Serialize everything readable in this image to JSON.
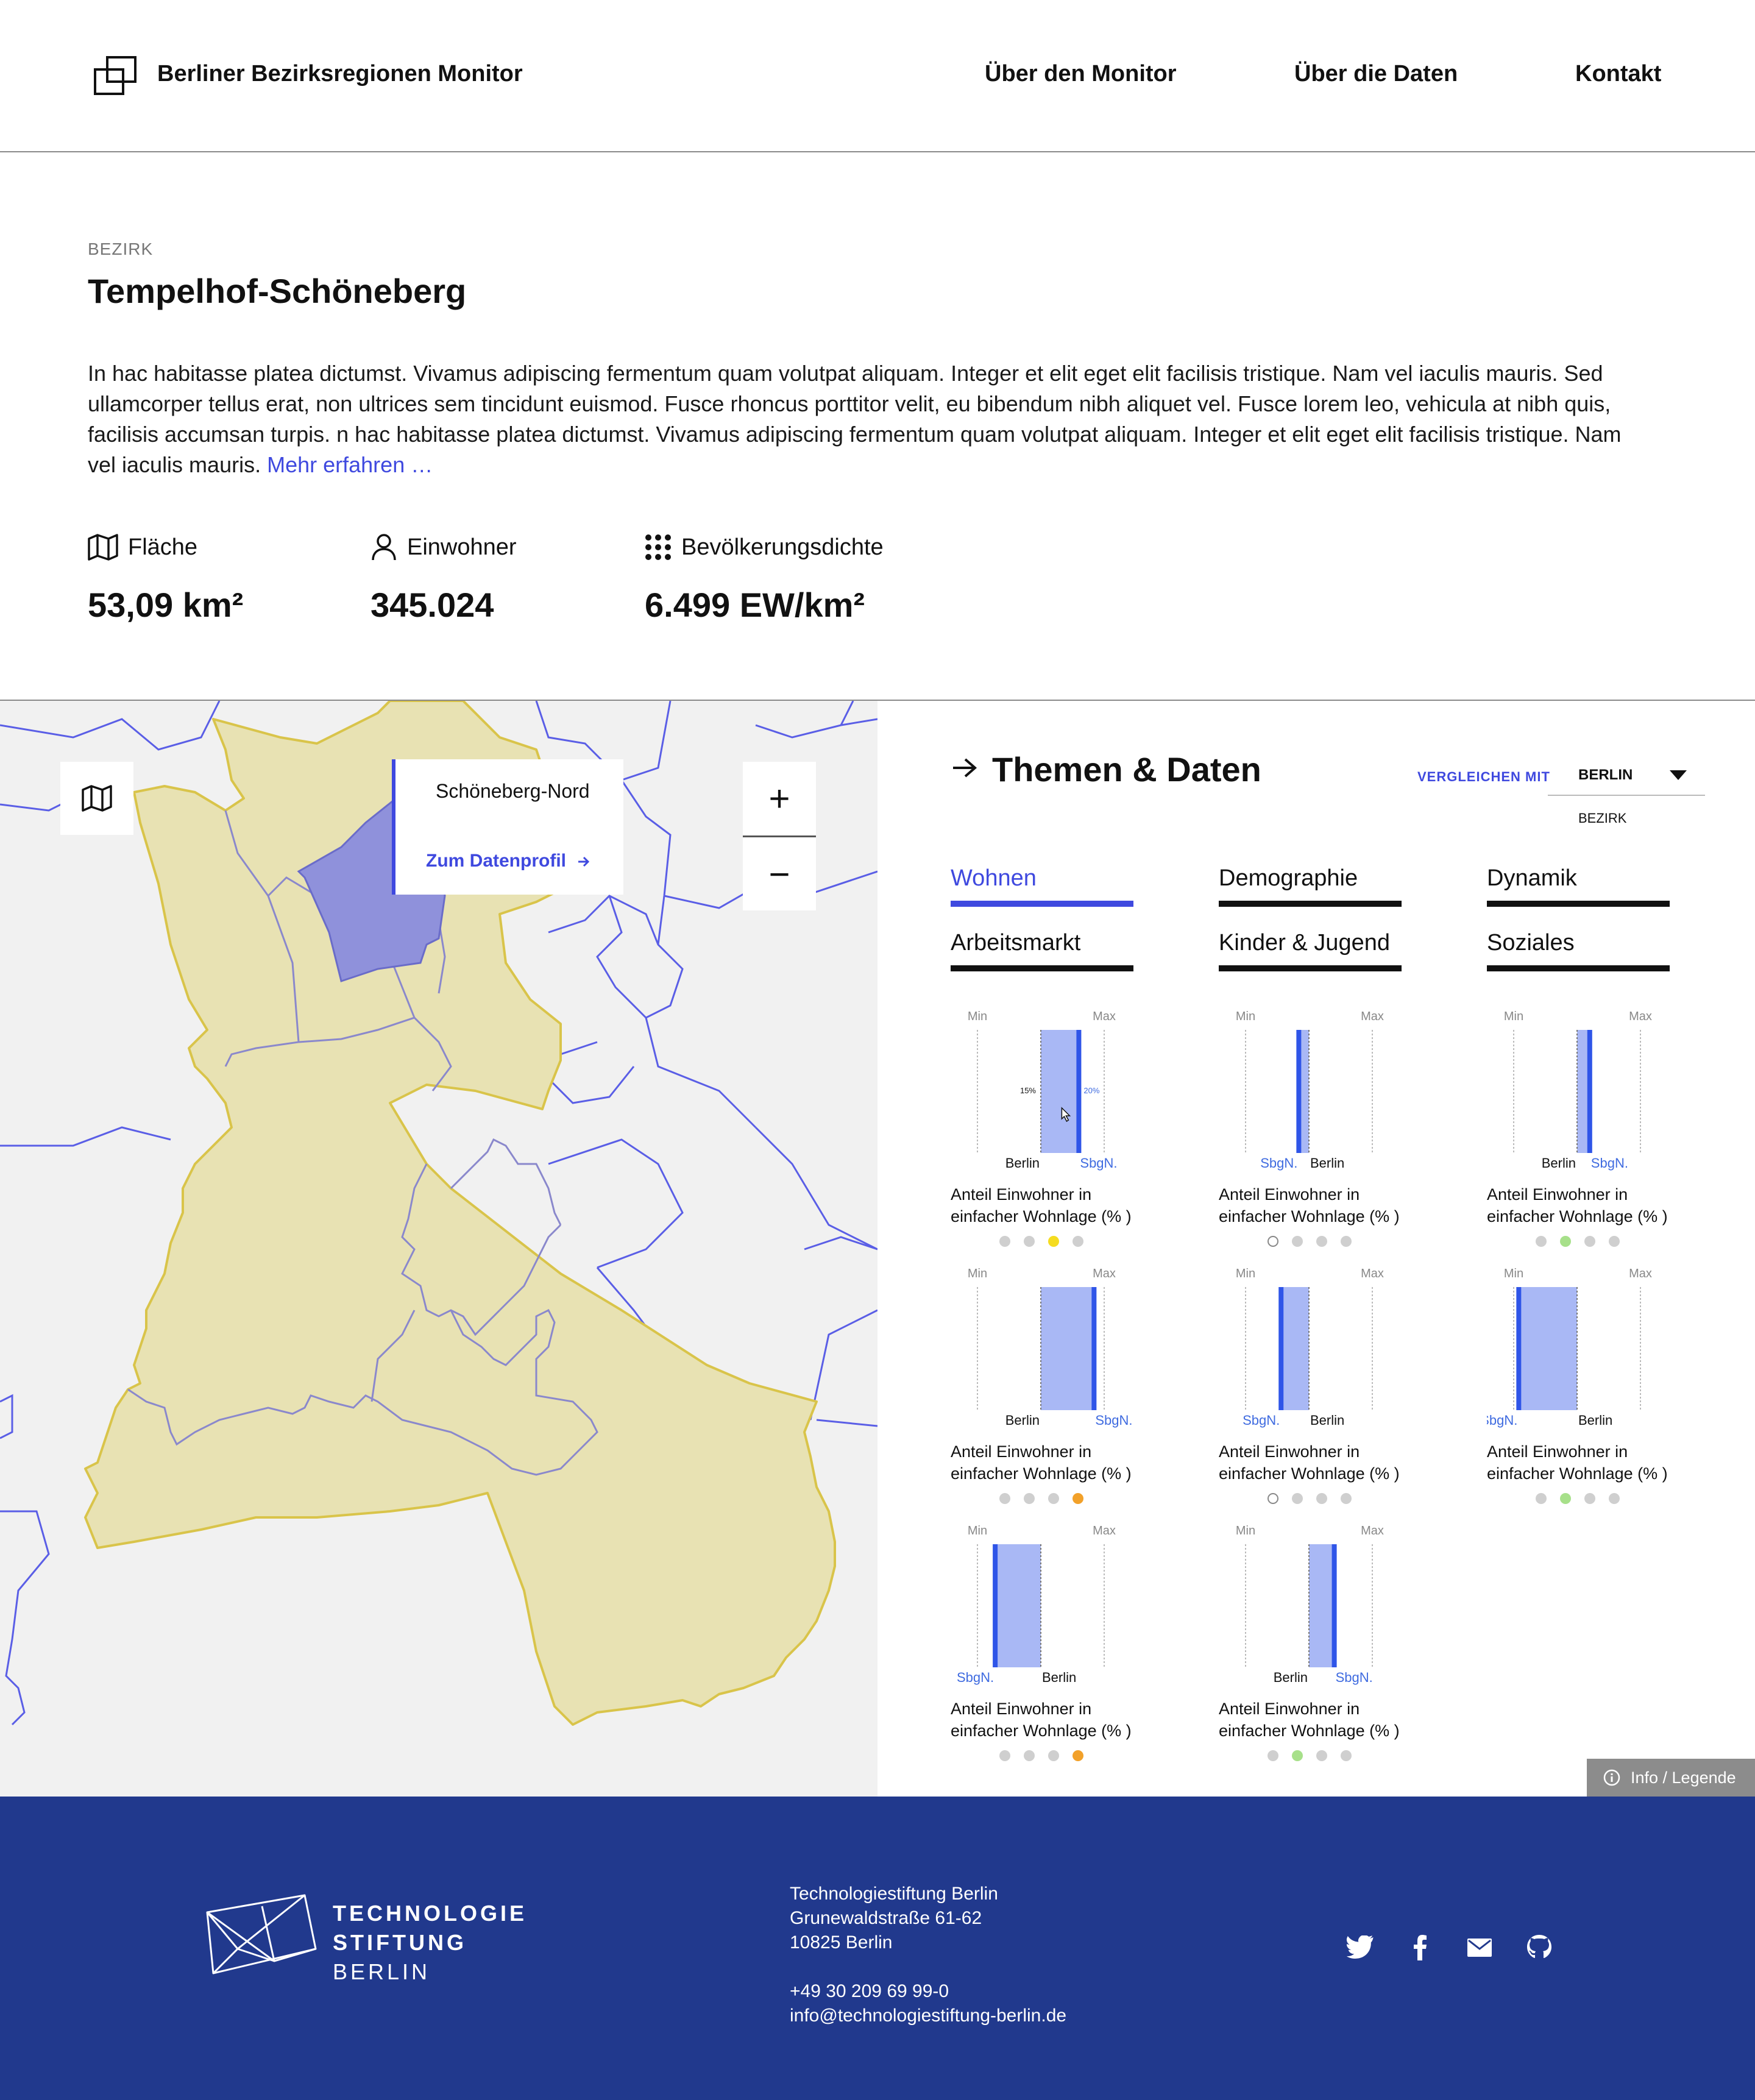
{
  "header": {
    "brand": "Berliner Bezirksregionen Monitor",
    "nav": [
      "Über den Monitor",
      "Über die Daten",
      "Kontakt"
    ]
  },
  "intro": {
    "kicker": "BEZIRK",
    "title": "Tempelhof-Schöneberg",
    "description": "In hac habitasse platea dictumst. Vivamus adipiscing fermentum quam volutpat aliquam. Integer et elit eget elit facilisis tristique. Nam vel iaculis mauris. Sed ullamcorper tellus erat, non ultrices sem tincidunt euismod. Fusce rhoncus porttitor velit, eu bibendum nibh aliquet vel. Fusce lorem leo, vehicula at nibh quis, facilisis accumsan turpis. n hac habitasse platea dictumst. Vivamus adipiscing fermentum quam volutpat aliquam. Integer et elit eget elit facilisis tristique. Nam vel iaculis mauris.",
    "more_link": "Mehr erfahren …",
    "stats": [
      {
        "icon": "map-icon",
        "label": "Fläche",
        "value": "53,09 km²"
      },
      {
        "icon": "person-icon",
        "label": "Einwohner",
        "value": "345.024"
      },
      {
        "icon": "density-grid-icon",
        "label": "Bevölkerungsdichte",
        "value": "6.499 EW/km²"
      }
    ]
  },
  "map": {
    "popup_name": "Schöneberg-Nord",
    "popup_link": "Zum Datenprofil",
    "zoom_in": "+",
    "zoom_out": "−",
    "colors": {
      "district_fill": "#e8e2b3",
      "district_stroke": "#d9c44a",
      "region_stroke": "#8a88cc",
      "selected": "#8f91db",
      "other_stroke": "#5a5ee6",
      "background": "#f1f1f1"
    }
  },
  "panel": {
    "title": "Themen & Daten",
    "compare_label": "VERGLEICHEN MIT",
    "compare_value": "BERLIN",
    "compare_option": "BEZIRK",
    "tabs": [
      "Wohnen",
      "Demographie",
      "Dynamik",
      "Arbeitsmarkt",
      "Kinder & Jugend",
      "Soziales"
    ],
    "active_tab": "Wohnen",
    "axis_min": "Min",
    "axis_max": "Max",
    "berlin_label": "Berlin",
    "region_label": "SbgN.",
    "indicator_label": "Anteil Einwohner in einfacher Wohnlage (% )",
    "first_berlin_value": "15%",
    "first_region_value": "20%",
    "indicators": [
      {
        "berlin": 0.5,
        "region": 0.8,
        "status": [
          "grey",
          "grey",
          "yellow",
          "grey"
        ]
      },
      {
        "berlin": 0.5,
        "region": 0.42,
        "status": [
          "hollow",
          "grey",
          "grey",
          "grey"
        ]
      },
      {
        "berlin": 0.5,
        "region": 0.6,
        "status": [
          "grey",
          "green",
          "grey",
          "grey"
        ]
      },
      {
        "berlin": 0.5,
        "region": 0.92,
        "status": [
          "grey",
          "grey",
          "grey",
          "orange"
        ]
      },
      {
        "berlin": 0.5,
        "region": 0.28,
        "status": [
          "hollow",
          "grey",
          "grey",
          "grey"
        ]
      },
      {
        "berlin": 0.5,
        "region": 0.04,
        "status": [
          "grey",
          "green",
          "grey",
          "grey"
        ]
      },
      {
        "berlin": 0.5,
        "region": 0.14,
        "status": [
          "grey",
          "grey",
          "grey",
          "orange"
        ]
      },
      {
        "berlin": 0.5,
        "region": 0.7,
        "status": [
          "grey",
          "green",
          "grey",
          "grey"
        ]
      }
    ],
    "status_colors": {
      "grey": "#cfcfcf",
      "yellow": "#f5dc20",
      "green": "#a7e08a",
      "orange": "#f2a12a"
    },
    "info_button": "Info / Legende"
  },
  "footer": {
    "brand_lines": [
      "TECHNOLOGIE",
      "STIFTUNG",
      "BERLIN"
    ],
    "address": [
      "Technologiestiftung Berlin",
      "Grunewaldstraße 61-62",
      "10825 Berlin",
      "",
      "+49 30 209 69 99-0",
      "info@technologiestiftung-berlin.de"
    ],
    "social": [
      "twitter-icon",
      "facebook-icon",
      "mail-icon",
      "github-icon"
    ]
  }
}
